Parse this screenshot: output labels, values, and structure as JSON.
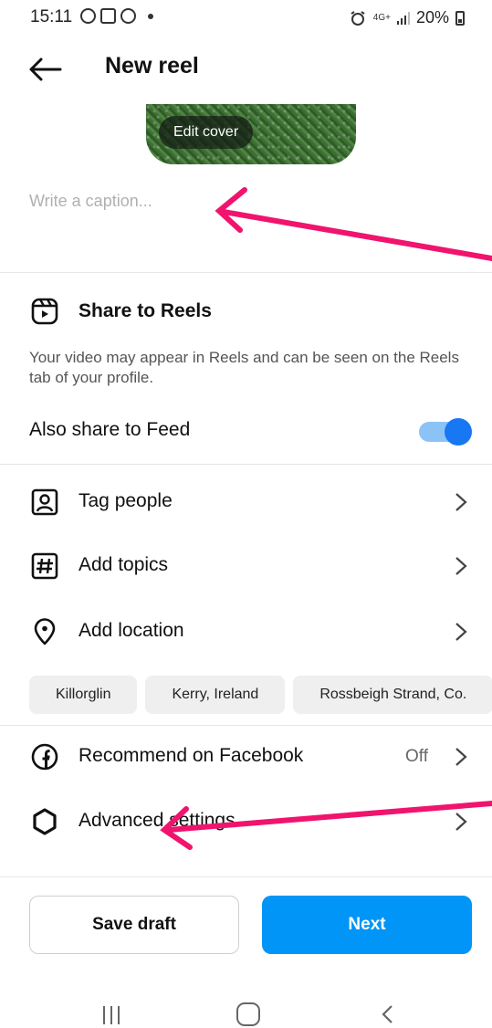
{
  "status_bar": {
    "time": "15:11",
    "network": "4G+",
    "battery": "20%"
  },
  "header": {
    "title": "New reel"
  },
  "cover": {
    "edit_label": "Edit cover"
  },
  "caption": {
    "placeholder": "Write a caption..."
  },
  "share_reels": {
    "title": "Share to Reels",
    "description": "Your video may appear in Reels and can be seen on the Reels tab of your profile.",
    "feed_label": "Also share to Feed",
    "feed_enabled": true
  },
  "rows": {
    "tag_people": "Tag people",
    "add_topics": "Add topics",
    "add_location": "Add location",
    "recommend_facebook": "Recommend on Facebook",
    "recommend_value": "Off",
    "advanced": "Advanced settings"
  },
  "locations": [
    "Killorglin",
    "Kerry, Ireland",
    "Rossbeigh Strand, Co."
  ],
  "buttons": {
    "save_draft": "Save draft",
    "next": "Next"
  },
  "colors": {
    "accent": "#0095f6",
    "toggle": "#1877f2",
    "annotation": "#f0146e"
  },
  "icons": [
    "back-arrow-icon",
    "reels-icon",
    "tag-people-icon",
    "hashtag-icon",
    "location-pin-icon",
    "facebook-icon",
    "gear-icon",
    "chevron-right-icon"
  ]
}
